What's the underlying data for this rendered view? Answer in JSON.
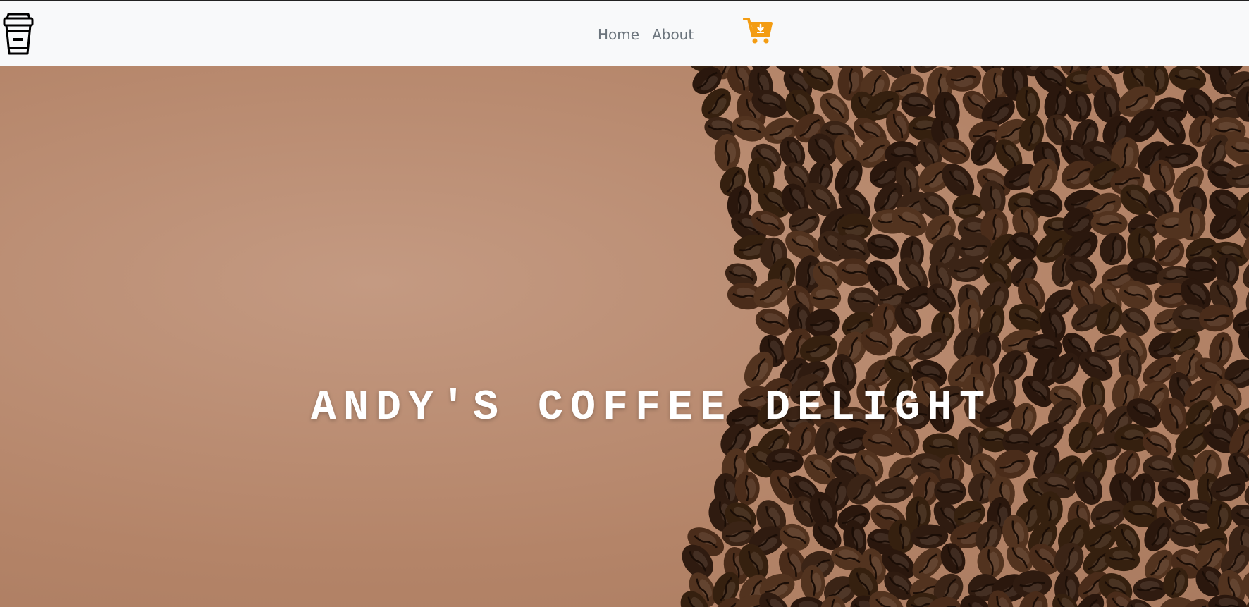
{
  "navbar": {
    "brand_icon": "coffee-cup-icon",
    "links": [
      {
        "label": "Home"
      },
      {
        "label": "About"
      }
    ],
    "cart_icon": "cart-download-icon",
    "cart_color": "#f39c12"
  },
  "hero": {
    "title": "ANDY'S COFFEE DELIGHT",
    "background_color": "#b98b71",
    "bean_color": "#3b2416"
  }
}
